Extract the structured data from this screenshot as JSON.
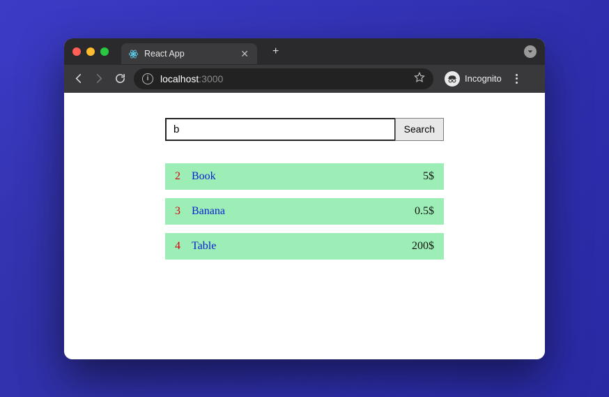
{
  "browser": {
    "tab": {
      "title": "React App"
    },
    "address": {
      "host": "localhost",
      "port": ":3000"
    },
    "incognito_label": "Incognito"
  },
  "search": {
    "value": "b",
    "button_label": "Search"
  },
  "results": [
    {
      "id": "2",
      "name": "Book",
      "price": "5$"
    },
    {
      "id": "3",
      "name": "Banana",
      "price": "0.5$"
    },
    {
      "id": "4",
      "name": "Table",
      "price": "200$"
    }
  ]
}
